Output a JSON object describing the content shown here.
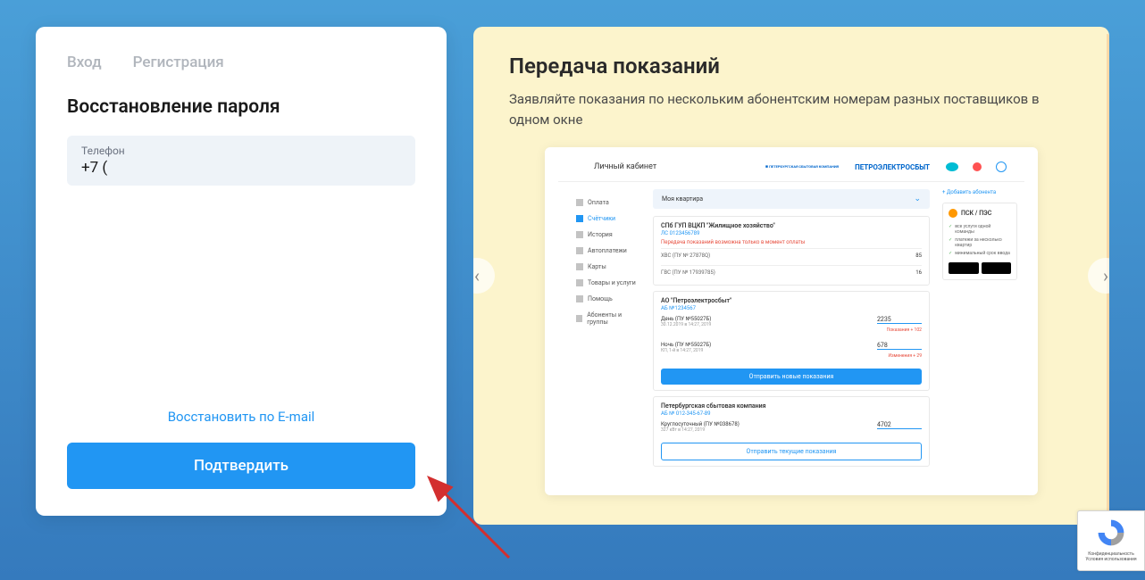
{
  "tabs": {
    "login": "Вход",
    "register": "Регистрация"
  },
  "form": {
    "title": "Восстановление пароля",
    "phone_label": "Телефон",
    "phone_value": "+7 (",
    "email_link": "Восстановить по E-mail",
    "confirm": "Подтвердить"
  },
  "promo": {
    "title": "Передача показаний",
    "desc": "Заявляйте показания по нескольким абонентским номерам разных поставщиков в одном окне"
  },
  "preview": {
    "header_title": "Личный кабинет",
    "brand1": "ПЕТЕРБУРГСКАЯ СБЫТОВАЯ КОМПАНИЯ",
    "brand2": "ПЕТРОЭЛЕКТРОСБЫТ",
    "sidebar": [
      "Оплата",
      "Счётчики",
      "История",
      "Автоплатежи",
      "Карты",
      "Товары и услуги",
      "Помощь",
      "Абоненты и группы"
    ],
    "dropdown": "Моя квартира",
    "add_subscriber": "+ Добавить абонента",
    "supplier1": {
      "name": "СПб ГУП ВЦКП \"Жилищное хозяйство\"",
      "sub": "ЛС 0123456789",
      "warn": "Передача показаний возможна только в момент оплаты",
      "meters": [
        {
          "label": "ХВС (ПУ № 27878Q)",
          "val": "85"
        },
        {
          "label": "ГВС (ПУ № 17939785)",
          "val": "16"
        }
      ]
    },
    "supplier2": {
      "name": "АО \"Петроэлектросбыт\"",
      "sub": "АБ №1234567",
      "readings": [
        {
          "label": "День (ПУ №55027Б)",
          "sub": "30.12.2019 в 14:27, 2019",
          "val": "2235",
          "note": "Показания + 102"
        },
        {
          "label": "Ночь (ПУ №55027Б)",
          "sub": "КП, 1-й в 14:27, 2019",
          "val": "678",
          "note": "Изменения + 29"
        }
      ],
      "send": "Отправить новые показания"
    },
    "supplier3": {
      "name": "Петербургская сбытовая компания",
      "sub": "АБ № 012-345-67-89",
      "reading": {
        "label": "Круглосуточный (ПУ №038678)",
        "sub": "327 кВт в 14:27, 2019",
        "val": "4702"
      },
      "send": "Отправить текущие показания"
    },
    "promo_box": {
      "title": "ПСК / ПЭС",
      "lines": [
        "все услуги одной команды",
        "платежи за несколько квартир",
        "минимальный срок ввода"
      ]
    }
  },
  "recaptcha": {
    "line1": "Конфиденциальность",
    "line2": "Условия использования"
  }
}
